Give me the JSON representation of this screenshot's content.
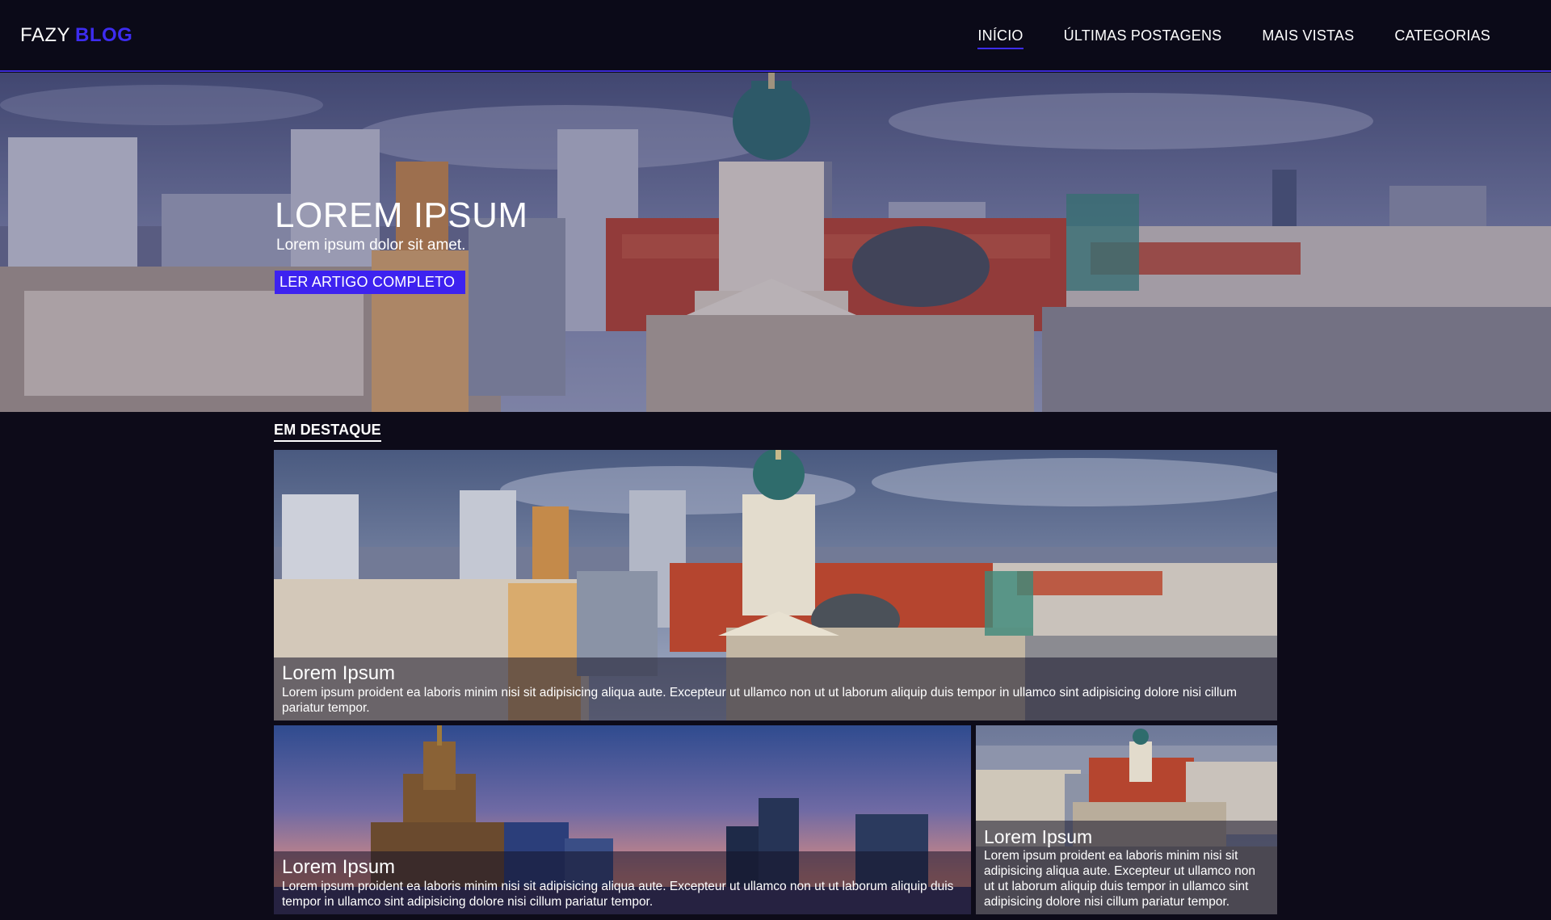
{
  "brand": {
    "part1": "FAZY",
    "part2": "BLOG"
  },
  "nav": {
    "items": [
      {
        "label": "INÍCIO",
        "active": true
      },
      {
        "label": "ÚLTIMAS POSTAGENS",
        "active": false
      },
      {
        "label": "MAIS VISTAS",
        "active": false
      },
      {
        "label": "CATEGORIAS",
        "active": false
      }
    ]
  },
  "hero": {
    "title": "LOREM IPSUM",
    "subtitle": "Lorem ipsum dolor sit amet.",
    "button": "LER ARTIGO COMPLETO"
  },
  "featured": {
    "heading": "EM DESTAQUE",
    "cards": [
      {
        "title": "Lorem Ipsum",
        "text": "Lorem ipsum proident ea laboris minim nisi sit adipisicing aliqua aute. Excepteur ut ullamco non ut ut laborum aliquip duis tempor in ullamco sint adipisicing dolore nisi cillum pariatur tempor."
      },
      {
        "title": "Lorem Ipsum",
        "text": "Lorem ipsum proident ea laboris minim nisi sit adipisicing aliqua aute. Excepteur ut ullamco non ut ut laborum aliquip duis tempor in ullamco sint adipisicing dolore nisi cillum pariatur tempor."
      },
      {
        "title": "Lorem Ipsum",
        "text": "Lorem ipsum proident ea laboris minim nisi sit adipisicing aliqua aute. Excepteur ut ullamco non ut ut laborum aliquip duis tempor in ullamco sint adipisicing dolore nisi cillum pariatur tempor."
      }
    ]
  },
  "colors": {
    "background": "#0d0b19",
    "navbar": "#0b0a18",
    "accent": "#3d22f0"
  }
}
